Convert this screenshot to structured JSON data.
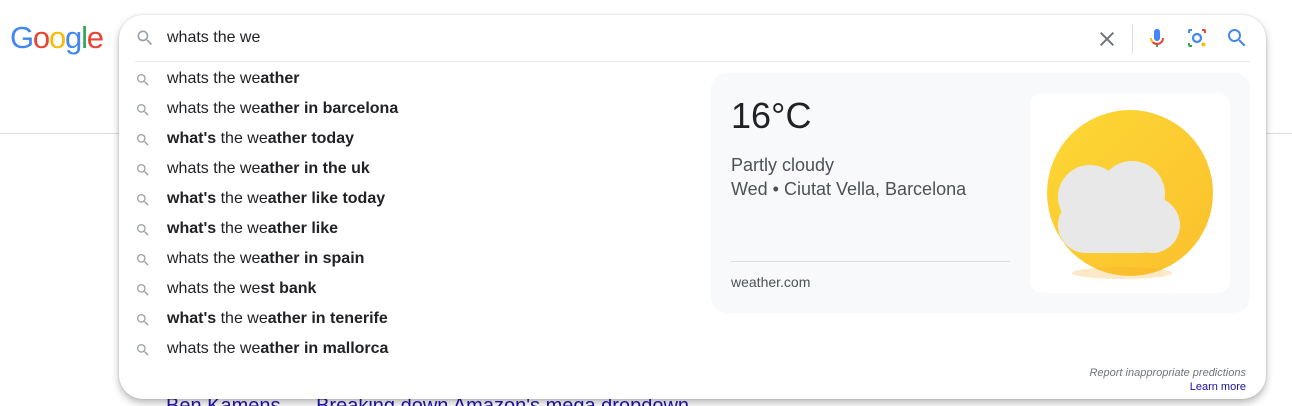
{
  "logo": {
    "letters": [
      {
        "char": "G",
        "color": "#4285f4"
      },
      {
        "char": "o",
        "color": "#ea4335"
      },
      {
        "char": "o",
        "color": "#fbbc05"
      },
      {
        "char": "g",
        "color": "#4285f4"
      },
      {
        "char": "l",
        "color": "#34a853"
      },
      {
        "char": "e",
        "color": "#ea4335"
      }
    ]
  },
  "search": {
    "value": "whats the we",
    "icon": "search-icon"
  },
  "toolbar": {
    "clear_icon": "close-icon",
    "mic_icon": "microphone-icon",
    "lens_icon": "google-lens-icon",
    "search_icon": "search-icon"
  },
  "suggestions": [
    {
      "normal_prefix": "",
      "bold_prefix": "",
      "plain": "whats the we",
      "bold": "ather"
    },
    {
      "normal_prefix": "",
      "bold_prefix": "",
      "plain": "whats the we",
      "bold": "ather in barcelona"
    },
    {
      "normal_prefix": "",
      "bold_prefix": "what's",
      "plain": " the we",
      "bold": "ather today"
    },
    {
      "normal_prefix": "",
      "bold_prefix": "",
      "plain": "whats the we",
      "bold": "ather in the uk"
    },
    {
      "normal_prefix": "",
      "bold_prefix": "what's",
      "plain": " the we",
      "bold": "ather like today"
    },
    {
      "normal_prefix": "",
      "bold_prefix": "what's",
      "plain": " the we",
      "bold": "ather like"
    },
    {
      "normal_prefix": "",
      "bold_prefix": "",
      "plain": "whats the we",
      "bold": "ather in spain"
    },
    {
      "normal_prefix": "",
      "bold_prefix": "",
      "plain": "whats the we",
      "bold": "st bank"
    },
    {
      "normal_prefix": "",
      "bold_prefix": "what's",
      "plain": " the we",
      "bold": "ather in tenerife"
    },
    {
      "normal_prefix": "",
      "bold_prefix": "",
      "plain": "whats the we",
      "bold": "ather in mallorca"
    }
  ],
  "weather": {
    "temperature": "16°C",
    "condition": "Partly cloudy",
    "location_line": "Wed • Ciutat Vella, Barcelona",
    "source": "weather.com",
    "icon": "partly-cloudy-icon"
  },
  "footer": {
    "report": "Report inappropriate predictions",
    "learn_more": "Learn more"
  },
  "background_results": [
    "Ben Kamens",
    "Breaking down Amazon's mega dropdown"
  ],
  "colors": {
    "link": "#1a0dab",
    "text": "#202124",
    "secondary_text": "#4d5156",
    "sun": "#fdd835"
  }
}
